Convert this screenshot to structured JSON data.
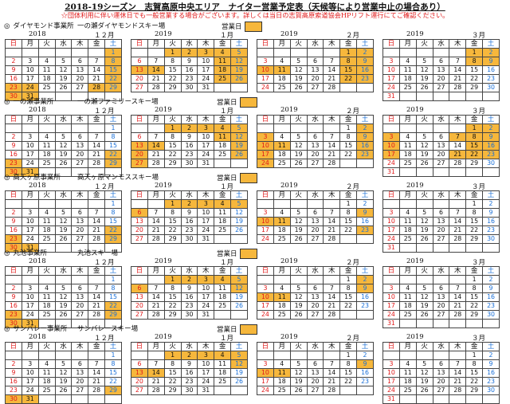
{
  "title": "2018-19シーズン　志賀高原中央エリア　ナイター営業予定表（天候等により営業中止の場合あり）",
  "notice": "☆団体利用に伴い運休日でも一般営業する場合がございます。詳しくは当日の志賀高原索道協会HPリフト運行にてご確認ください。",
  "weekday_labels": [
    "日",
    "月",
    "火",
    "水",
    "木",
    "金",
    "土"
  ],
  "legend_label": "営業日",
  "colors": {
    "operating": "#F6B73C",
    "sunday": "#e01a1a",
    "saturday": "#1a6fd6"
  },
  "months": [
    {
      "year": "2018",
      "label": "１２月",
      "start": 6,
      "days": 31
    },
    {
      "year": "2019",
      "label": "１月",
      "start": 2,
      "days": 31
    },
    {
      "year": "2019",
      "label": "２月",
      "start": 5,
      "days": 28
    },
    {
      "year": "2019",
      "label": "３月",
      "start": 5,
      "days": 31
    }
  ],
  "sections": [
    {
      "office": "ダイヤモンド事業所",
      "ski": "一の瀬ダイヤモンドスキー場",
      "operating": [
        [
          1,
          8,
          15,
          22,
          23,
          24,
          28,
          29,
          30,
          31
        ],
        [
          1,
          2,
          3,
          4,
          5,
          11,
          12,
          13,
          14,
          18,
          19,
          25,
          26
        ],
        [
          1,
          2,
          8,
          9,
          10,
          11,
          15,
          16,
          22,
          23
        ],
        [
          1,
          2,
          8,
          9
        ]
      ]
    },
    {
      "office": "一の瀬事業所",
      "ski": "一の瀬ファミリースキー場",
      "operating": [
        [
          22,
          23,
          29,
          30,
          31
        ],
        [
          1,
          2,
          3,
          4,
          5,
          11,
          12,
          13,
          14,
          19,
          20,
          26,
          27
        ],
        [
          2,
          3,
          9,
          10,
          11,
          16,
          17,
          23,
          24
        ],
        [
          1,
          2,
          3,
          7,
          8,
          9,
          10,
          15,
          16,
          17,
          21,
          22,
          23
        ]
      ]
    },
    {
      "office": "高天ヶ原事業所",
      "ski": "高天ヶ原マンモススキー場",
      "operating": [
        [
          22,
          23,
          29,
          30,
          31
        ],
        [
          1,
          2,
          3,
          4,
          5,
          6
        ],
        [
          9,
          10,
          11,
          23
        ],
        []
      ]
    },
    {
      "office": "丸池事業所",
      "ski": "丸池スキー場",
      "operating": [
        [
          22,
          23,
          29,
          30,
          31
        ],
        [
          1,
          2,
          3,
          4,
          5,
          6,
          12
        ],
        [
          2,
          9,
          10,
          11
        ],
        []
      ]
    },
    {
      "office": "サンバレー事業所",
      "ski": "サンバレースキー場",
      "operating": [
        [
          29,
          30,
          31
        ],
        [
          1,
          2,
          3,
          4,
          5,
          12,
          13,
          14
        ],
        [
          9,
          10,
          11
        ],
        []
      ]
    }
  ]
}
